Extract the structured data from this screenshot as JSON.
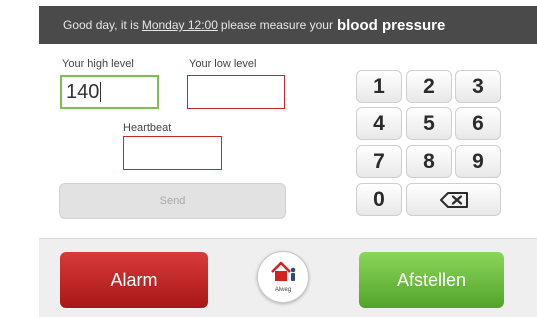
{
  "banner": {
    "prefix": "Good day, it is",
    "datetime": "Monday 12:00",
    "middle": "please measure your",
    "emphasis": "blood pressure"
  },
  "form": {
    "high_label": "Your high level",
    "high_value": "140",
    "low_label": "Your low level",
    "low_value": "",
    "heartbeat_label": "Heartbeat",
    "heartbeat_value": "",
    "send_label": "Send"
  },
  "keypad": {
    "keys": [
      "1",
      "2",
      "3",
      "4",
      "5",
      "6",
      "7",
      "8",
      "9",
      "0"
    ],
    "backspace_icon": "backspace-icon"
  },
  "footer": {
    "alarm_label": "Alarm",
    "home_caption": "Alweg",
    "home_icon": "home-person-icon",
    "afstellen_label": "Afstellen"
  },
  "colors": {
    "banner_bg": "#4a4a4a",
    "alarm_red": "#c62828",
    "confirm_green": "#6cc13f",
    "active_field_border": "#7ec04f",
    "invalid_field_border": "#c62828"
  }
}
